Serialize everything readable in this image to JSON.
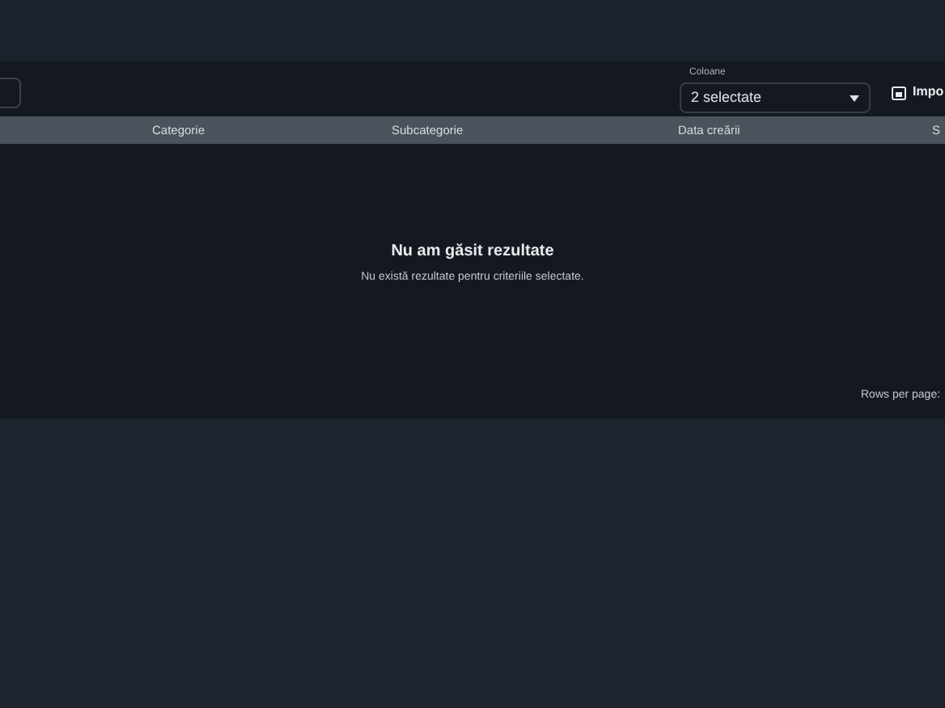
{
  "toolbar": {
    "columns_select": {
      "label": "Coloane",
      "value": "2 selectate"
    },
    "import_button": {
      "label": "Impo"
    }
  },
  "table": {
    "columns": [
      "Categorie",
      "Subcategorie",
      "Data creării",
      "S"
    ],
    "empty_state": {
      "title": "Nu am găsit rezultate",
      "message": "Nu există rezultate pentru criteriile selectate."
    },
    "footer": {
      "rows_per_page": "Rows per page:"
    }
  }
}
